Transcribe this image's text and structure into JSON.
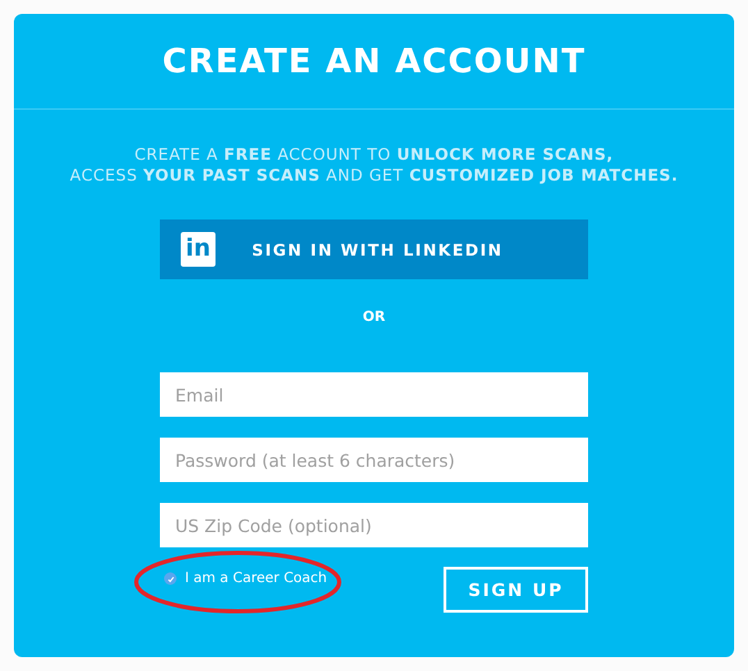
{
  "title": "CREATE AN ACCOUNT",
  "intro": "CREATE A **FREE** ACCOUNT TO **UNLOCK MORE SCANS,**\nACCESS **YOUR PAST SCANS** AND GET **CUSTOMIZED JOB MATCHES.**",
  "linkedin_button": {
    "logo": "in",
    "label": "SIGN IN WITH LINKEDIN"
  },
  "separator": "OR",
  "fields": [
    {
      "placeholder": "Email"
    },
    {
      "placeholder": "Password (at least 6 characters)"
    },
    {
      "placeholder": "US Zip Code (optional)"
    }
  ],
  "career_coach": {
    "label": "I am a Career Coach",
    "checked": true,
    "circled": true
  },
  "submit_button": "SIGN UP"
}
